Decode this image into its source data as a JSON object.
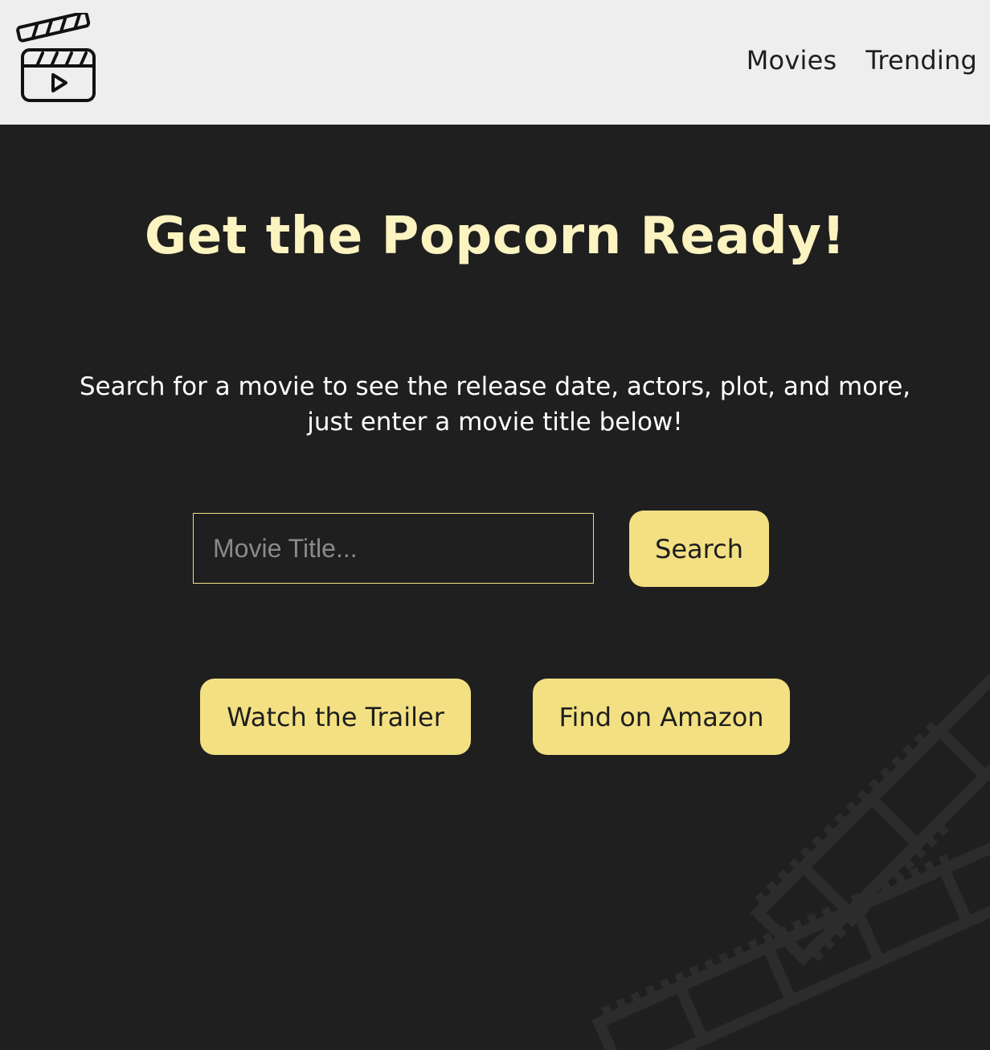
{
  "header": {
    "logo_icon": "clapperboard-play-icon",
    "nav": [
      {
        "label": "Movies"
      },
      {
        "label": "Trending"
      }
    ]
  },
  "hero": {
    "title": "Get the Popcorn Ready!",
    "subtitle": "Search for a movie to see the release date, actors, plot, and more, just enter a movie title below!"
  },
  "search": {
    "placeholder": "Movie Title...",
    "value": "",
    "button_label": "Search"
  },
  "actions": {
    "trailer_label": "Watch the Trailer",
    "amazon_label": "Find on Amazon"
  },
  "colors": {
    "background": "#1f1f1f",
    "header_bg": "#eeeeee",
    "accent": "#f3e082",
    "title": "#fbf3c0"
  }
}
